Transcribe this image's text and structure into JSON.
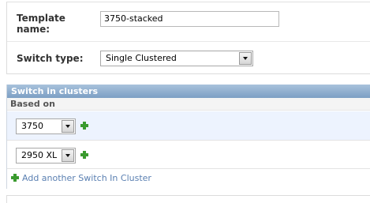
{
  "template": {
    "name_label": "Template name:",
    "name_value": "3750-stacked",
    "switch_type_label": "Switch type:",
    "switch_type_value": "Single Clustered"
  },
  "inline": {
    "title": "Switch in clusters",
    "column_header": "Based on",
    "rows": [
      {
        "based_on": "3750"
      },
      {
        "based_on": "2950 XL"
      }
    ],
    "add_link": "Add another Switch In Cluster"
  },
  "colors": {
    "header_blue": "#7c9fc4",
    "link_blue": "#5b80b2",
    "plus_green": "#3a9a2e",
    "row_highlight": "#edf3fe"
  },
  "icons": [
    "chevron-down-icon",
    "add-plus-icon"
  ]
}
